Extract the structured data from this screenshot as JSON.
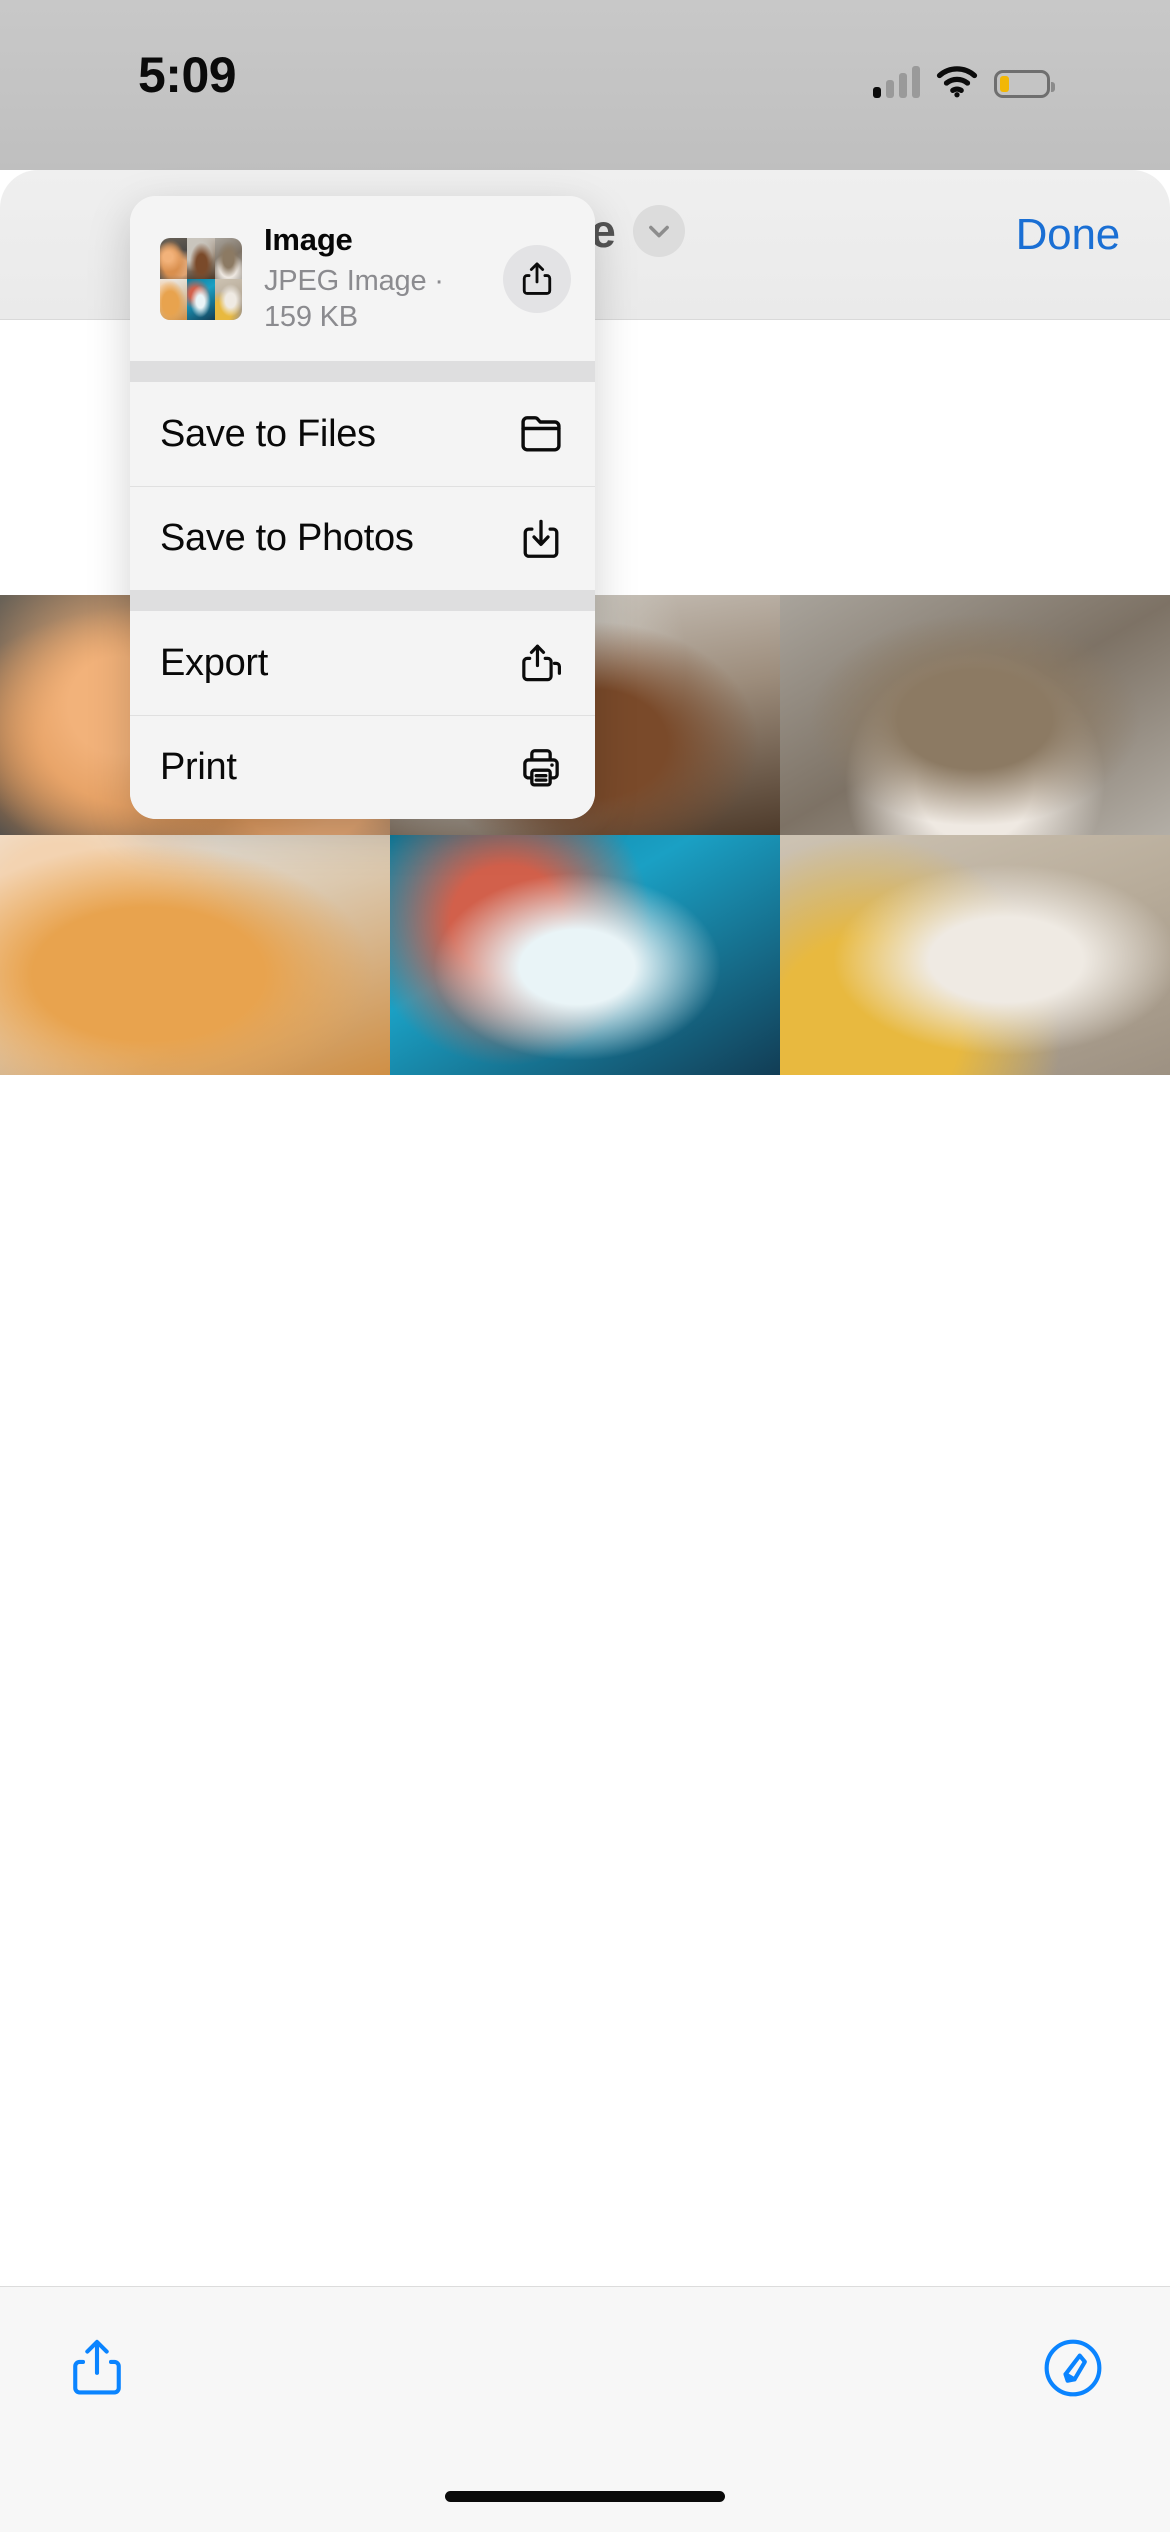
{
  "status_bar": {
    "time": "5:09",
    "icons": [
      "cellular-signal-icon",
      "wifi-icon",
      "battery-icon"
    ],
    "battery_state": "low",
    "battery_color": "#f2b705"
  },
  "navbar": {
    "title": "Image",
    "chevron_icon": "chevron-down-icon",
    "done_label": "Done",
    "accent_color": "#1a6fd4"
  },
  "popup_menu": {
    "file": {
      "name": "Image",
      "subtitle": "JPEG Image · 159 KB",
      "type": "JPEG Image",
      "size": "159 KB",
      "thumbnail_icon": "image-thumbnail",
      "share_icon": "share-icon"
    },
    "groups": [
      {
        "items": [
          {
            "label": "Save to Files",
            "icon": "folder-icon"
          },
          {
            "label": "Save to Photos",
            "icon": "download-icon"
          }
        ]
      },
      {
        "items": [
          {
            "label": "Export",
            "icon": "export-icon"
          },
          {
            "label": "Print",
            "icon": "printer-icon"
          }
        ]
      }
    ]
  },
  "photo_grid": {
    "count": 6,
    "items": [
      {
        "alt": "ginger cat lying on back"
      },
      {
        "alt": "tabby cat sleeping on bed"
      },
      {
        "alt": "grey tabby cat facing camera"
      },
      {
        "alt": "orange long-haired cat profile"
      },
      {
        "alt": "fluffy cat with butterfly on nose"
      },
      {
        "alt": "grey and white cat on sofa"
      }
    ]
  },
  "toolbar": {
    "share_icon": "share-icon",
    "markup_icon": "markup-pen-icon",
    "accent_color": "#0a84ff"
  }
}
